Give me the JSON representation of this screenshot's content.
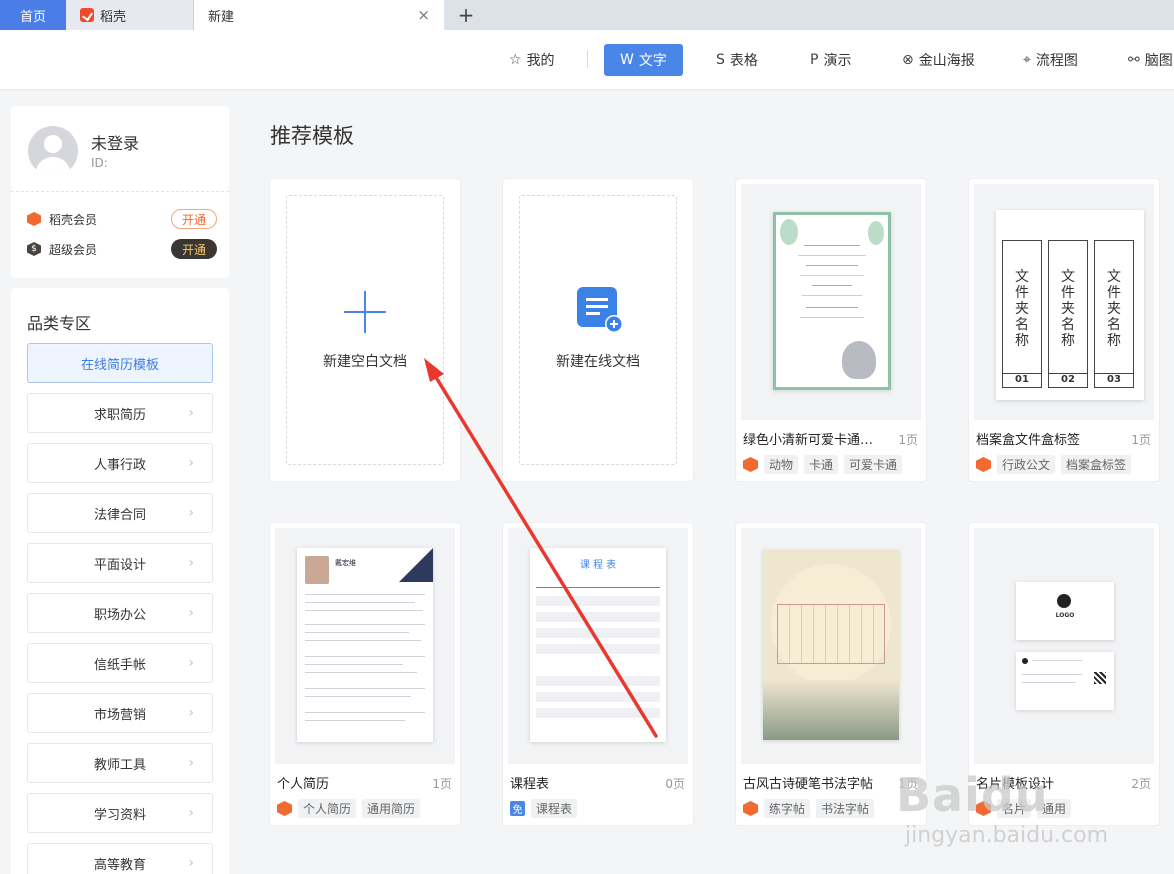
{
  "tabs": {
    "home": "首页",
    "daoke": "稻壳",
    "new_tab": "新建",
    "close": "×",
    "add": "+"
  },
  "categories": [
    {
      "label": "我的",
      "icon": "star-icon"
    },
    {
      "label": "文字",
      "icon": "w-icon"
    },
    {
      "label": "表格",
      "icon": "s-icon"
    },
    {
      "label": "演示",
      "icon": "p-icon"
    },
    {
      "label": "金山海报",
      "icon": "poster-icon"
    },
    {
      "label": "流程图",
      "icon": "flow-icon"
    },
    {
      "label": "脑图",
      "icon": "mindmap-icon"
    }
  ],
  "user": {
    "name": "未登录",
    "id_label": "ID:"
  },
  "membership": [
    {
      "label": "稻壳会员",
      "button": "开通"
    },
    {
      "label": "超级会员",
      "button": "开通"
    }
  ],
  "category_panel": {
    "title": "品类专区",
    "items": [
      "在线简历模板",
      "求职简历",
      "人事行政",
      "法律合同",
      "平面设计",
      "职场办公",
      "信纸手帐",
      "市场营销",
      "教师工具",
      "学习资料",
      "高等教育"
    ]
  },
  "main": {
    "section_title": "推荐模板",
    "new_blank": "新建空白文档",
    "new_online": "新建在线文档",
    "templates": [
      {
        "name": "绿色小清新可爱卡通动...",
        "pages": "1页",
        "badge": "hex",
        "tags": [
          "动物",
          "卡通",
          "可爱卡通"
        ]
      },
      {
        "name": "档案盒文件盒标签",
        "pages": "1页",
        "badge": "hex",
        "tags": [
          "行政公文",
          "档案盒标签"
        ]
      },
      {
        "name": "个人简历",
        "pages": "1页",
        "badge": "hex",
        "tags": [
          "个人简历",
          "通用简历"
        ]
      },
      {
        "name": "课程表",
        "pages": "0页",
        "badge": "free",
        "badge_text": "免",
        "tags": [
          "课程表"
        ]
      },
      {
        "name": "古风古诗硬笔书法字帖",
        "pages": "1页",
        "badge": "hex",
        "tags": [
          "练字帖",
          "书法字帖"
        ]
      },
      {
        "name": "名片模板设计",
        "pages": "2页",
        "badge": "hex",
        "tags": [
          "名片",
          "通用"
        ]
      }
    ]
  },
  "thumb_text": {
    "folder_title": "文件夹名称",
    "folder_nums": [
      "01",
      "02",
      "03"
    ],
    "schedule_title": "课 程 表",
    "logo": "LOGO",
    "resume_name": "戴宏维"
  },
  "watermark": {
    "main": "Baidu",
    "sub": "jingyan.baidu.com"
  },
  "colors": {
    "accent": "#4a86e8",
    "orange": "#f06a32",
    "arrow": "#e8382f"
  }
}
